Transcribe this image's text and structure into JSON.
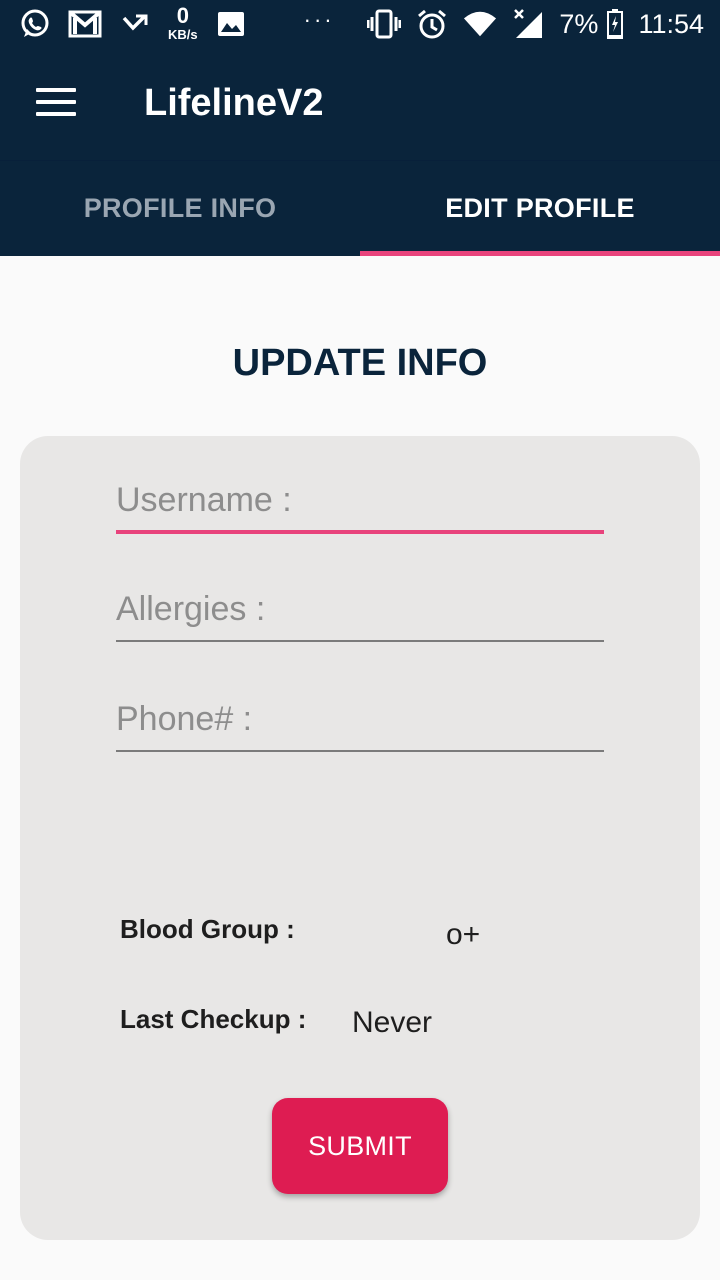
{
  "status_bar": {
    "net_speed_value": "0",
    "net_speed_unit": "KB/s",
    "more": "···",
    "battery": "7%",
    "time": "11:54",
    "icons_left": [
      "whatsapp-icon",
      "gmail-icon",
      "missed-call-icon",
      "net-speed",
      "gallery-icon"
    ],
    "icons_right": [
      "vibrate-icon",
      "alarm-icon",
      "wifi-icon",
      "signal-icon",
      "battery-icon"
    ]
  },
  "app_bar": {
    "title": "LifelineV2",
    "menu_icon": "hamburger-menu-icon"
  },
  "tabs": [
    {
      "label": "PROFILE INFO",
      "active": false
    },
    {
      "label": "EDIT PROFILE",
      "active": true
    }
  ],
  "main": {
    "heading": "UPDATE INFO",
    "fields": {
      "username_placeholder": "Username :",
      "allergies_placeholder": "Allergies :",
      "phone_placeholder": "Phone# :"
    },
    "blood_group_label": "Blood Group :",
    "blood_group_value": "o+",
    "last_checkup_label": "Last Checkup :",
    "last_checkup_value": "Never",
    "submit_label": "SUBMIT"
  },
  "colors": {
    "primary_dark": "#0a243b",
    "accent": "#e8437c",
    "submit_button": "#de1c52",
    "card_background": "#e8e7e6",
    "page_background": "#fafafa"
  }
}
